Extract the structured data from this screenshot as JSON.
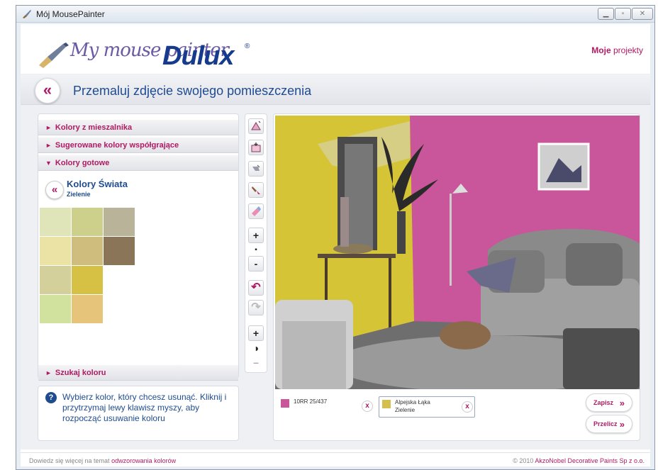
{
  "window": {
    "title": "Mój MousePainter"
  },
  "header": {
    "logo_text": "My mouse painter",
    "brand": "Dulux",
    "brand_reg": "®",
    "projects_link_bold": "Moje",
    "projects_link_rest": " projekty"
  },
  "page": {
    "back_glyph": "«",
    "title": "Przemaluj zdjęcie swojego pomieszczenia"
  },
  "sidebar": {
    "sections": [
      {
        "label": "Kolory z mieszalnika",
        "expanded": false
      },
      {
        "label": "Sugerowane kolory współgrające",
        "expanded": false
      },
      {
        "label": "Kolory gotowe",
        "expanded": true
      },
      {
        "label": "Szukaj koloru",
        "expanded": false
      }
    ],
    "collapsed_marker": "►",
    "expanded_marker": "▼",
    "palette": {
      "back_glyph": "«",
      "name": "Kolory Świata",
      "subname": "Zielenie",
      "swatches": [
        [
          "#dfe5b8",
          "#ccd08a",
          "#b9b39a"
        ],
        [
          "#ebe3a6",
          "#cfbd7e",
          "#8a7558"
        ],
        [
          "#d4d09c",
          "#d7c145",
          null
        ],
        [
          "#d1e29e",
          "#e6c57a",
          null
        ]
      ]
    }
  },
  "help": {
    "icon": "?",
    "text": "Wybierz kolor, który chcesz usunąć. Kliknij i przytrzymaj lewy klawisz myszy, aby rozpocząć usuwanie koloru"
  },
  "toolbar": {
    "tools": [
      {
        "name": "fill-area-tool-icon",
        "glyph": ""
      },
      {
        "name": "add-area-tool-icon",
        "glyph": ""
      },
      {
        "name": "pencil-tool-icon",
        "glyph": ""
      },
      {
        "name": "brush-tool-icon",
        "glyph": ""
      },
      {
        "name": "eraser-tool-icon",
        "glyph": ""
      },
      {
        "name": "size-plus-button",
        "glyph": "+"
      },
      {
        "name": "size-indicator",
        "glyph": "▪"
      },
      {
        "name": "size-minus-button",
        "glyph": "-"
      },
      {
        "name": "undo-button",
        "glyph": "↶"
      },
      {
        "name": "redo-button",
        "glyph": "↷"
      },
      {
        "name": "contrast-plus-button",
        "glyph": "+"
      },
      {
        "name": "contrast-icon",
        "glyph": "◑"
      },
      {
        "name": "contrast-minus-button",
        "glyph": "–"
      }
    ]
  },
  "colors_used": [
    {
      "name": "10RR 25/437",
      "sub": "",
      "color": "#c9569a",
      "remove": "x"
    },
    {
      "name": "Alpejska Łąka",
      "sub": "Zielenie",
      "color": "#d4bf4e",
      "remove": "x"
    }
  ],
  "actions": {
    "save": "Zapisz",
    "recalc": "Przelicz",
    "arrow": "»"
  },
  "footer": {
    "left_prefix": "Dowiedz się więcej na temat ",
    "left_link": "odwzorowania kolorów",
    "right_prefix": "© 2010 ",
    "right_link": "AkzoNobel Decorative Paints Sp z o.o."
  },
  "theme": {
    "accent": "#b01963",
    "brand_blue": "#1f4b8f",
    "wall_pink": "#c9569a",
    "wall_yellow": "#d4c436"
  }
}
